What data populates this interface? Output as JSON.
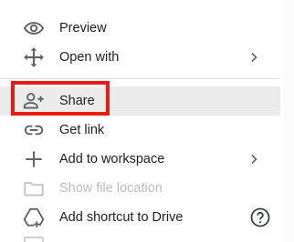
{
  "menu": {
    "items": [
      {
        "id": "preview",
        "label": "Preview",
        "icon": "eye-icon",
        "submenu": false,
        "disabled": false
      },
      {
        "id": "open-with",
        "label": "Open with",
        "icon": "move-arrows-icon",
        "submenu": true,
        "disabled": false
      },
      {
        "id": "share",
        "label": "Share",
        "icon": "person-add-icon",
        "submenu": false,
        "disabled": false,
        "highlighted": true
      },
      {
        "id": "get-link",
        "label": "Get link",
        "icon": "link-icon",
        "submenu": false,
        "disabled": false
      },
      {
        "id": "add-to-workspace",
        "label": "Add to workspace",
        "icon": "plus-icon",
        "submenu": true,
        "disabled": false
      },
      {
        "id": "show-file-location",
        "label": "Show file location",
        "icon": "folder-icon",
        "submenu": false,
        "disabled": true
      },
      {
        "id": "add-shortcut",
        "label": "Add shortcut to Drive",
        "icon": "add-to-drive-icon",
        "submenu": false,
        "disabled": false,
        "help": true
      }
    ]
  },
  "colors": {
    "text": "#202124",
    "disabled_text": "#bdbdbd",
    "highlight_bg": "#ececec",
    "callout_border": "#ea1c12",
    "icon": "#5f6368"
  }
}
